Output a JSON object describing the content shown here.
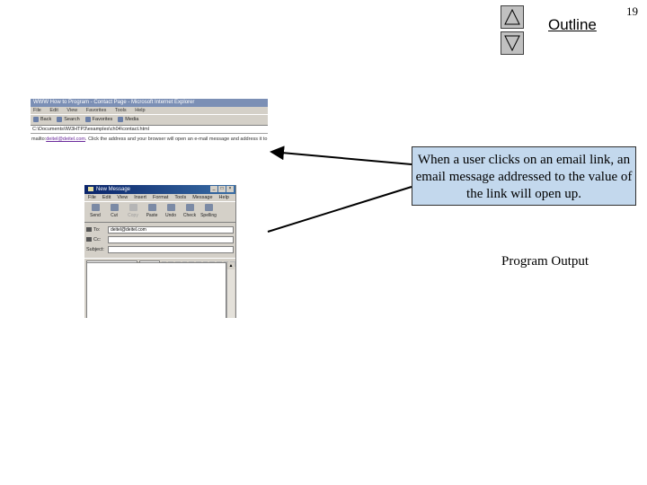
{
  "nav": {
    "outline_label": "Outline",
    "slide_number": "19"
  },
  "browser_window": {
    "title": "WWW How to Program - Contact Page - Microsoft Internet Explorer",
    "menu": [
      "File",
      "Edit",
      "View",
      "Favorites",
      "Tools",
      "Help"
    ],
    "toolbar": [
      "Back",
      "Search",
      "Favorites",
      "Media"
    ],
    "address": "C:\\Documents\\IW3HTP3\\examples\\ch04\\contact.html",
    "content_prefix": "mailto:",
    "content_link": "deitel@deitel.com",
    "content_suffix": ". Click the address and your browser will open an e-mail message and address it to"
  },
  "email_window": {
    "title": "New Message",
    "menu": [
      "File",
      "Edit",
      "View",
      "Insert",
      "Format",
      "Tools",
      "Message",
      "Help"
    ],
    "toolbar": [
      "Send",
      "Cut",
      "Copy",
      "Paste",
      "Undo",
      "Check",
      "Spelling"
    ],
    "to_label": "To:",
    "to_value": "deitel@deitel.com",
    "cc_label": "Cc:",
    "cc_value": "",
    "subject_label": "Subject:",
    "subject_value": ""
  },
  "callout": {
    "text": "When a user clicks on an email link, an email message addressed to the value of the link will open up."
  },
  "program_output_label": "Program Output",
  "colors": {
    "callout_bg": "#c3d8ed",
    "link": "#6b2b9c",
    "nav_button": "#c0c0c0"
  },
  "icons": {
    "nav_up": "triangle-up-icon",
    "nav_down": "triangle-down-icon"
  }
}
